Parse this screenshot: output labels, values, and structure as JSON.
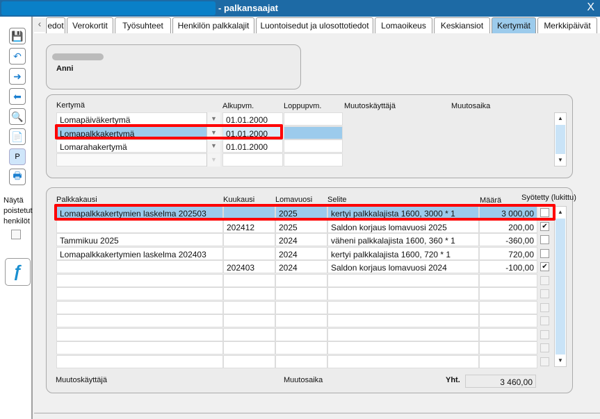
{
  "window": {
    "title": "- palkansaajat",
    "close": "X"
  },
  "toolbar": {
    "icons": [
      "save-icon",
      "undo-icon",
      "forward-icon",
      "back-icon",
      "search-icon",
      "new-document-icon",
      "p-icon",
      "print-icon"
    ],
    "p_label": "P"
  },
  "sidebar": {
    "show_deleted_label": "Näytä poistetut henkilöt",
    "show_deleted_checked": false
  },
  "tabs": [
    {
      "label": "edot"
    },
    {
      "label": "Verokortit"
    },
    {
      "label": "Työsuhteet"
    },
    {
      "label": "Henkilön palkkalajit"
    },
    {
      "label": "Luontoisedut ja ulosottotiedot"
    },
    {
      "label": "Lomaoikeus"
    },
    {
      "label": "Keskiansiot"
    },
    {
      "label": "Kertymät",
      "active": true
    },
    {
      "label": "Merkkipäivät"
    }
  ],
  "person": {
    "name": "Anni"
  },
  "accruals": {
    "headers": {
      "kertyma": "Kertymä",
      "alku": "Alkupvm.",
      "loppu": "Loppupvm.",
      "user": "Muutoskäyttäjä",
      "time": "Muutosaika"
    },
    "rows": [
      {
        "kertyma": "Lomapäiväkertymä",
        "alku": "01.01.2000",
        "loppu": ""
      },
      {
        "kertyma": "Lomapalkkakertymä",
        "alku": "01.01.2000",
        "loppu": "",
        "selected": true
      },
      {
        "kertyma": "Lomarahakertymä",
        "alku": "01.01.2000",
        "loppu": ""
      },
      {
        "kertyma": "",
        "alku": "",
        "loppu": ""
      }
    ]
  },
  "entries": {
    "headers": {
      "palkkakausi": "Palkkakausi",
      "kuukausi": "Kuukausi",
      "lomavuosi": "Lomavuosi",
      "selite": "Selite",
      "maara": "Määrä",
      "syotetty": "Syötetty (lukittu)"
    },
    "rows": [
      {
        "palkkakausi": "Lomapalkkakertymien laskelma 202503",
        "kuukausi": "",
        "lomavuosi": "2025",
        "selite": "kertyi palkkalajista 1600, 3000 * 1",
        "maara": "3 000,00",
        "locked": false,
        "selected": true
      },
      {
        "palkkakausi": "",
        "kuukausi": "202412",
        "lomavuosi": "2025",
        "selite": "Saldon korjaus lomavuosi 2025",
        "maara": "200,00",
        "locked": true
      },
      {
        "palkkakausi": "Tammikuu 2025",
        "kuukausi": "",
        "lomavuosi": "2024",
        "selite": "väheni palkkalajista 1600, 360 * 1",
        "maara": "-360,00",
        "locked": false
      },
      {
        "palkkakausi": "Lomapalkkakertymien laskelma 202403",
        "kuukausi": "",
        "lomavuosi": "2024",
        "selite": "kertyi palkkalajista 1600, 720 * 1",
        "maara": "720,00",
        "locked": false
      },
      {
        "palkkakausi": "",
        "kuukausi": "202403",
        "lomavuosi": "2024",
        "selite": "Saldon korjaus lomavuosi 2024",
        "maara": "-100,00",
        "locked": true
      }
    ],
    "empty_rows": 7,
    "footer": {
      "user": "Muutoskäyttäjä",
      "time": "Muutosaika",
      "total_label": "Yht.",
      "total": "3 460,00"
    }
  },
  "colors": {
    "titlebar": "#1d6aa5",
    "selection": "#9ccbec",
    "highlight": "#ff0000"
  }
}
